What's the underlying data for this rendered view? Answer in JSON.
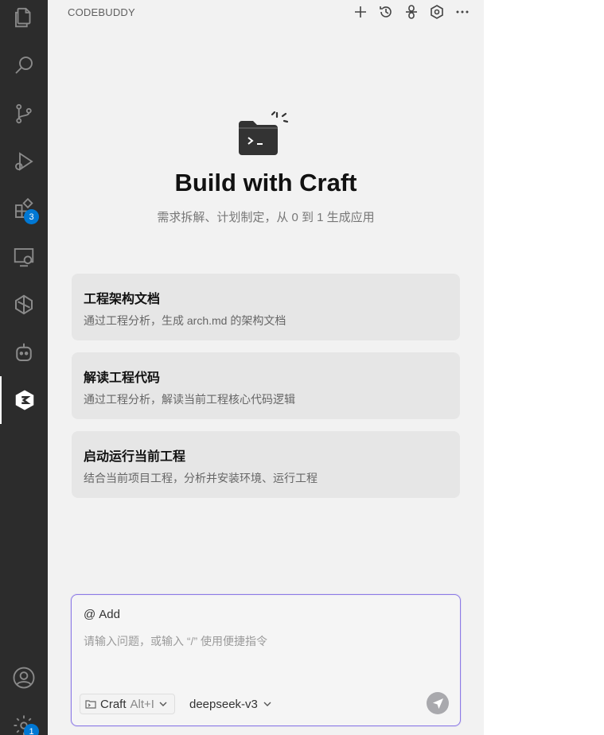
{
  "activity_bar": {
    "extensions_badge": "3",
    "settings_badge": "1"
  },
  "panel": {
    "title": "CODEBUDDY"
  },
  "hero": {
    "title": "Build with Craft",
    "subtitle": "需求拆解、计划制定，从 0 到 1 生成应用"
  },
  "cards": [
    {
      "title": "工程架构文档",
      "desc": "通过工程分析，生成 arch.md 的架构文档"
    },
    {
      "title": "解读工程代码",
      "desc": "通过工程分析，解读当前工程核心代码逻辑"
    },
    {
      "title": "启动运行当前工程",
      "desc": "结合当前项目工程，分析并安装环境、运行工程"
    }
  ],
  "input": {
    "add_label": "Add",
    "placeholder": "请输入问题，或输入 “/” 使用便捷指令",
    "mode": "Craft",
    "mode_shortcut": "Alt+I",
    "model": "deepseek-v3"
  },
  "colors": {
    "activity_bg": "#2c2c2c",
    "panel_bg": "#f2f2f2",
    "card_bg": "#e6e6e6",
    "input_border": "#8c7ae6",
    "badge": "#0078d4"
  }
}
